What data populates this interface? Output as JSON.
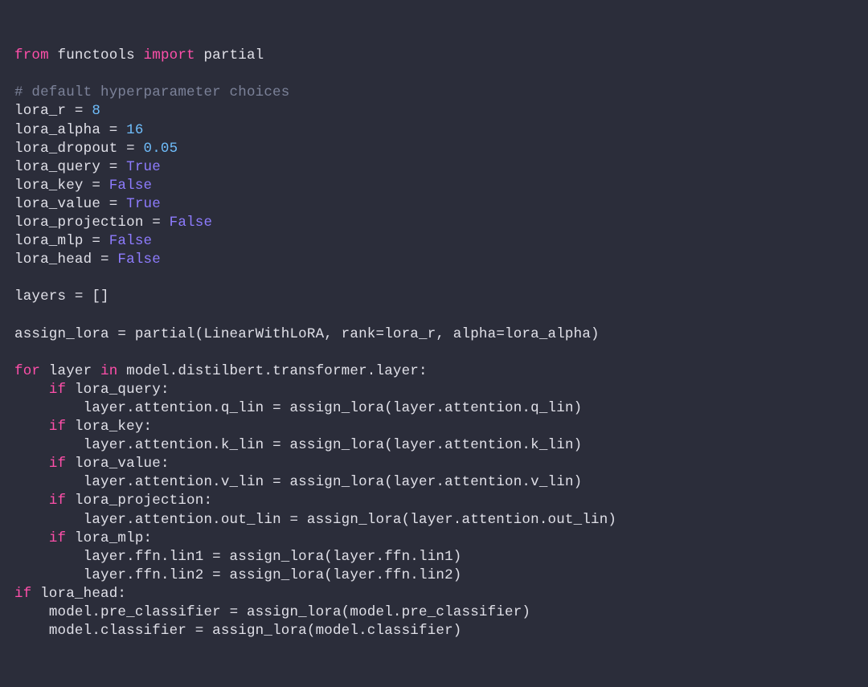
{
  "code": {
    "line1": {
      "kw1": "from",
      "mod": " functools ",
      "kw2": "import",
      "imp": " partial"
    },
    "line2": "",
    "line3": {
      "cmt": "# default hyperparameter choices"
    },
    "line4": {
      "lhs": "lora_r ",
      "eq": "=",
      "rhs": " 8"
    },
    "line5": {
      "lhs": "lora_alpha ",
      "eq": "=",
      "rhs": " 16"
    },
    "line6": {
      "lhs": "lora_dropout ",
      "eq": "=",
      "rhs": " 0.05"
    },
    "line7": {
      "lhs": "lora_query ",
      "eq": "=",
      "rhs": " True"
    },
    "line8": {
      "lhs": "lora_key ",
      "eq": "=",
      "rhs": " False"
    },
    "line9": {
      "lhs": "lora_value ",
      "eq": "=",
      "rhs": " True"
    },
    "line10": {
      "lhs": "lora_projection ",
      "eq": "=",
      "rhs": " False"
    },
    "line11": {
      "lhs": "lora_mlp ",
      "eq": "=",
      "rhs": " False"
    },
    "line12": {
      "lhs": "lora_head ",
      "eq": "=",
      "rhs": " False"
    },
    "line14": {
      "lhs": "layers ",
      "eq": "=",
      "rhs": " []"
    },
    "line16": {
      "lhs": "assign_lora ",
      "eq": "=",
      "rhs": " partial(LinearWithLoRA, rank",
      "eq2": "=",
      "rhs2": "lora_r, alpha",
      "eq3": "=",
      "rhs3": "lora_alpha)"
    },
    "line18": {
      "kw1": "for",
      "v1": " layer ",
      "kw2": "in",
      "v2": " model.distilbert.transformer.layer:"
    },
    "line19": {
      "indent": "    ",
      "kw": "if",
      "cond": " lora_query:"
    },
    "line20": {
      "indent": "        ",
      "lhs": "layer.attention.q_lin ",
      "eq": "=",
      "rhs": " assign_lora(layer.attention.q_lin)"
    },
    "line21": {
      "indent": "    ",
      "kw": "if",
      "cond": " lora_key:"
    },
    "line22": {
      "indent": "        ",
      "lhs": "layer.attention.k_lin ",
      "eq": "=",
      "rhs": " assign_lora(layer.attention.k_lin)"
    },
    "line23": {
      "indent": "    ",
      "kw": "if",
      "cond": " lora_value:"
    },
    "line24": {
      "indent": "        ",
      "lhs": "layer.attention.v_lin ",
      "eq": "=",
      "rhs": " assign_lora(layer.attention.v_lin)"
    },
    "line25": {
      "indent": "    ",
      "kw": "if",
      "cond": " lora_projection:"
    },
    "line26": {
      "indent": "        ",
      "lhs": "layer.attention.out_lin ",
      "eq": "=",
      "rhs": " assign_lora(layer.attention.out_lin)"
    },
    "line27": {
      "indent": "    ",
      "kw": "if",
      "cond": " lora_mlp:"
    },
    "line28": {
      "indent": "        ",
      "lhs": "layer.ffn.lin1 ",
      "eq": "=",
      "rhs": " assign_lora(layer.ffn.lin1)"
    },
    "line29": {
      "indent": "        ",
      "lhs": "layer.ffn.lin2 ",
      "eq": "=",
      "rhs": " assign_lora(layer.ffn.lin2)"
    },
    "line30": {
      "kw": "if",
      "cond": " lora_head:"
    },
    "line31": {
      "indent": "    ",
      "lhs": "model.pre_classifier ",
      "eq": "=",
      "rhs": " assign_lora(model.pre_classifier)"
    },
    "line32": {
      "indent": "    ",
      "lhs": "model.classifier ",
      "eq": "=",
      "rhs": " assign_lora(model.classifier)"
    }
  }
}
